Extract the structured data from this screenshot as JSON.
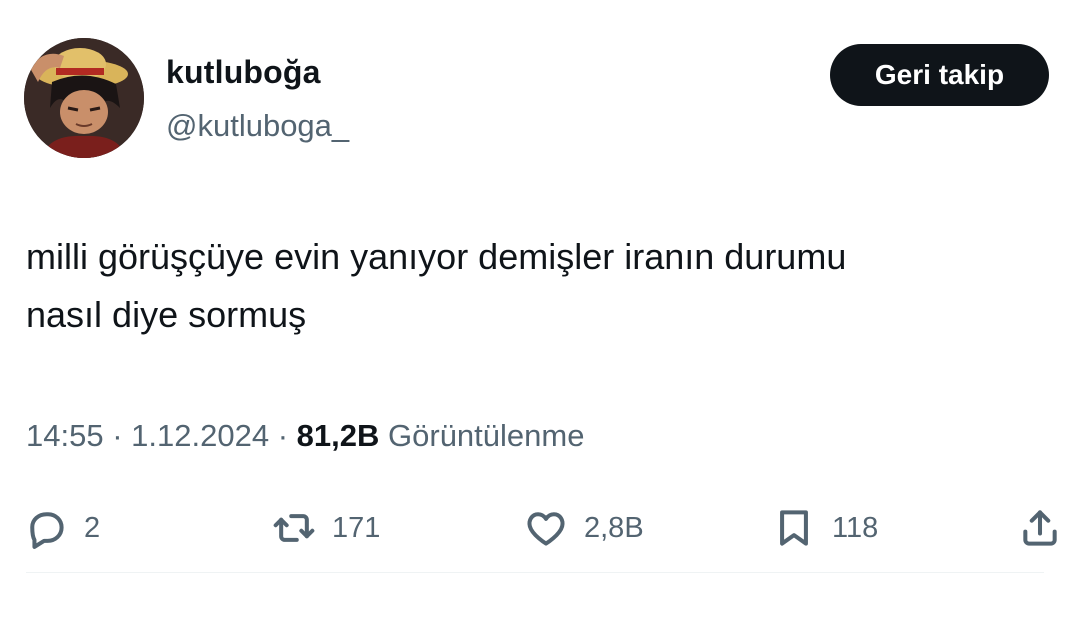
{
  "author": {
    "display_name": "kutluboğa",
    "handle": "@kutluboga_"
  },
  "follow_button": {
    "label": "Geri takip"
  },
  "tweet": {
    "text_line1": "milli görüşçüye evin yanıyor demişler iranın durumu",
    "text_line2": "nasıl diye sormuş"
  },
  "meta": {
    "time": "14:55",
    "separator": "·",
    "date": "1.12.2024",
    "views_count": "81,2B",
    "views_label": "Görüntülenme"
  },
  "actions": {
    "reply_count": "2",
    "retweet_count": "171",
    "like_count": "2,8B",
    "bookmark_count": "118"
  },
  "icons": {
    "reply": "reply-icon",
    "retweet": "retweet-icon",
    "like": "heart-icon",
    "bookmark": "bookmark-icon",
    "share": "share-icon"
  },
  "colors": {
    "text_primary": "#0f1419",
    "text_secondary": "#536471",
    "button_bg": "#0f1419",
    "divider": "#eff3f4"
  }
}
